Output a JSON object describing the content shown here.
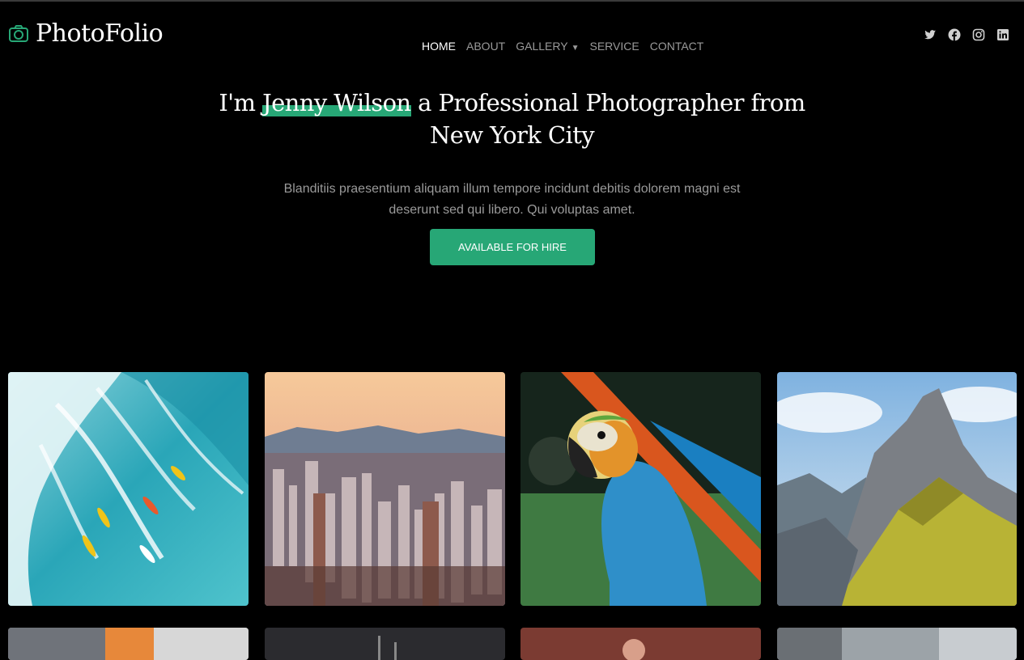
{
  "header": {
    "logo_text": "PhotoFolio",
    "nav": [
      {
        "label": "HOME",
        "active": true
      },
      {
        "label": "ABOUT"
      },
      {
        "label": "GALLERY",
        "dropdown": true
      },
      {
        "label": "SERVICE"
      },
      {
        "label": "CONTACT"
      }
    ],
    "social_icons": [
      "twitter-icon",
      "facebook-icon",
      "instagram-icon",
      "linkedin-icon"
    ]
  },
  "hero": {
    "title_prefix": "I'm",
    "title_highlight": "Jenny Wilson",
    "title_rest": "a Professional Photographer from",
    "title_line2": "New York City",
    "description": "Blanditiis praesentium aliquam illum tempore incidunt debitis dolorem magni est deserunt sed qui libero. Qui voluptas amet.",
    "cta_label": "AVAILABLE FOR HIRE"
  },
  "gallery": {
    "photos": [
      "surfers-photo",
      "city-skyline-photo",
      "parrot-photo",
      "mountain-photo",
      "building-photo",
      "night-city-photo",
      "portrait-photo",
      "street-photo"
    ]
  },
  "colors": {
    "accent": "#27a776",
    "background": "#000000",
    "muted_text": "#9a9a9a"
  }
}
